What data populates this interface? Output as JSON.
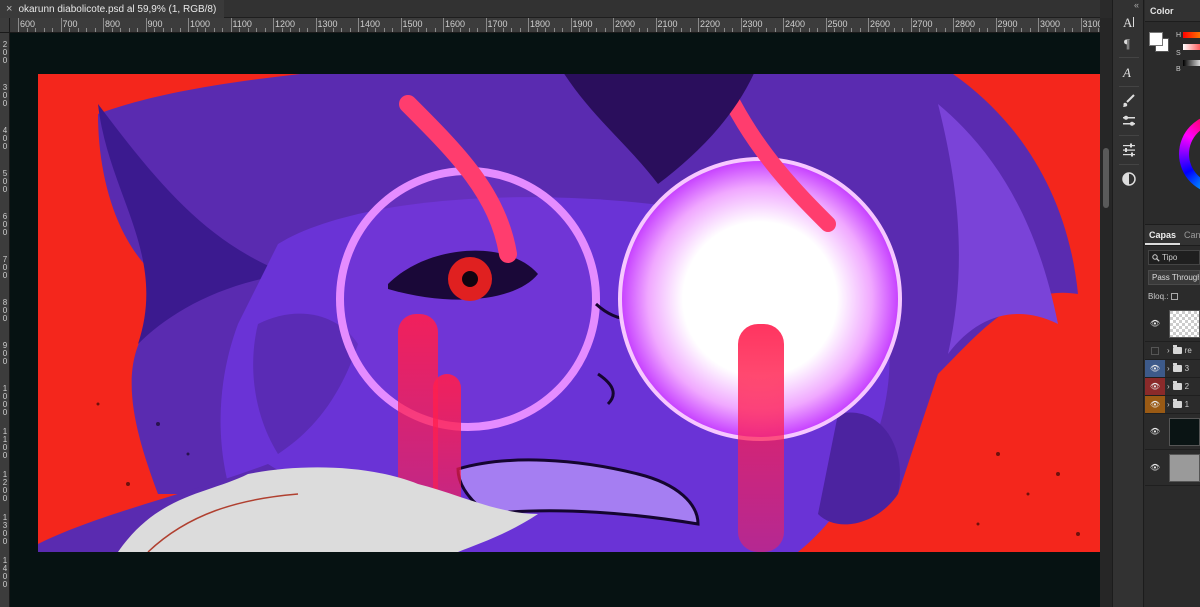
{
  "document": {
    "tab_title": "okarunn diabolicote.psd al 59,9% (1, RGB/8)",
    "close_glyph": "×"
  },
  "ruler": {
    "top_labels": [
      "600",
      "700",
      "800",
      "900",
      "1000",
      "1100",
      "1200",
      "1300",
      "1400",
      "1500",
      "1600",
      "1700",
      "1800",
      "1900",
      "2000",
      "2100",
      "2200",
      "2300",
      "2400",
      "2500",
      "2600",
      "2700",
      "2800",
      "2900",
      "3000",
      "3100"
    ],
    "left_labels": [
      "200",
      "300",
      "400",
      "500",
      "600",
      "700",
      "800",
      "900",
      "1000",
      "1100",
      "1200",
      "1300",
      "1400"
    ]
  },
  "tools": [
    {
      "icon": "character-icon"
    },
    {
      "icon": "paragraph-icon"
    },
    {
      "icon": "glyph-icon"
    },
    {
      "icon": "brush-icon"
    },
    {
      "icon": "brush-settings-icon"
    },
    {
      "icon": "adjustments-icon"
    },
    {
      "icon": "properties-icon"
    }
  ],
  "color_panel": {
    "title": "Color",
    "foreground": "#ffffff",
    "background": "#ffffff",
    "labels": {
      "h": "H",
      "s": "S",
      "b": "B"
    }
  },
  "layers_panel": {
    "tabs": [
      "Capas",
      "Canales"
    ],
    "search_placeholder": "Tipo",
    "blend_mode": "Pass Through",
    "lock_label": "Bloq.:",
    "layers": [
      {
        "type": "layer",
        "visible": true,
        "thumb": "transparent",
        "tag": "none"
      },
      {
        "type": "group",
        "visible": false,
        "name": "re",
        "tag": "none"
      },
      {
        "type": "group",
        "visible": true,
        "name": "3",
        "tag": "#3d5a8a"
      },
      {
        "type": "group",
        "visible": true,
        "name": "2",
        "tag": "#8a2a2a"
      },
      {
        "type": "group",
        "visible": true,
        "name": "1",
        "tag": "#9a5a14"
      },
      {
        "type": "layer",
        "visible": true,
        "thumb": "dark",
        "tag": "none"
      },
      {
        "type": "layer",
        "visible": true,
        "thumb": "gray",
        "tag": "none"
      }
    ]
  }
}
